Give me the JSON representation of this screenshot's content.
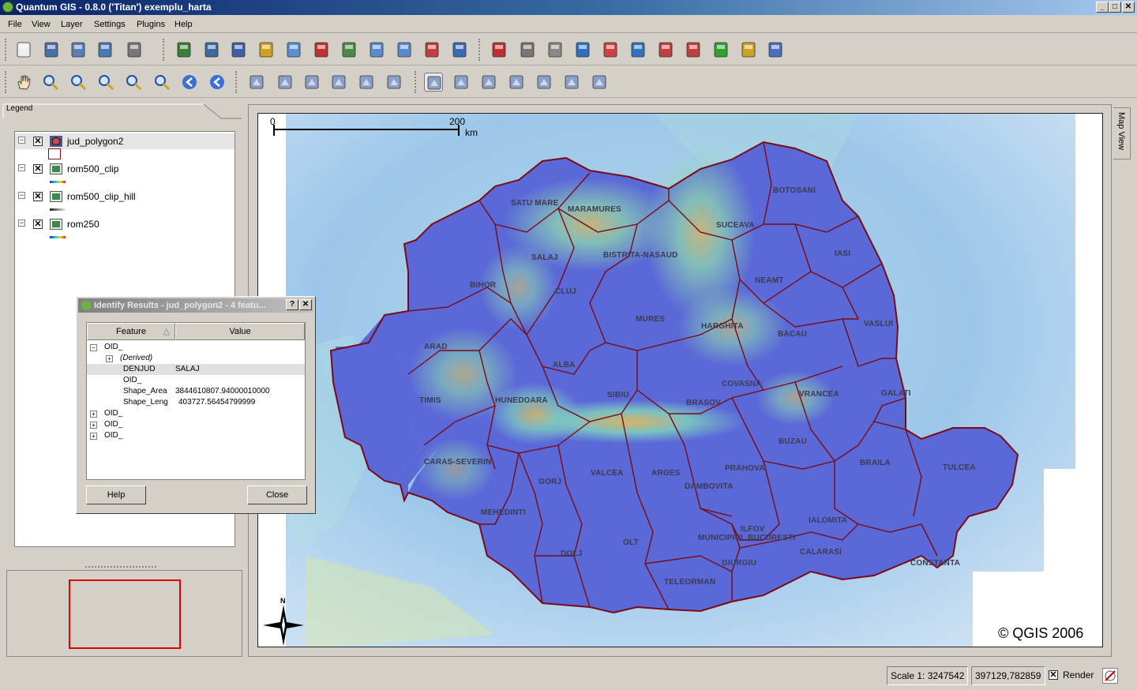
{
  "window": {
    "title": "Quantum GIS - 0.8.0 ('Titan')  exemplu_harta",
    "min": "_",
    "max": "□",
    "close": "✕"
  },
  "menu": [
    "File",
    "View",
    "Layer",
    "Settings",
    "Plugins",
    "Help"
  ],
  "legend": {
    "tab_label": "Legend",
    "layers": [
      {
        "name": "jud_polygon2",
        "checked": "✕",
        "expand": "−"
      },
      {
        "name": "rom500_clip",
        "checked": "✕",
        "expand": "−"
      },
      {
        "name": "rom500_clip_hill",
        "checked": "✕",
        "expand": "−"
      },
      {
        "name": "rom250",
        "checked": "✕",
        "expand": "−"
      }
    ]
  },
  "map": {
    "view_tab": "Map View",
    "scalebar": {
      "start": "0",
      "end": "200",
      "unit": "km"
    },
    "north": "N",
    "copyright": "© QGIS 2006",
    "labels": [
      "SATU MARE",
      "MARAMURES",
      "BOTOSANI",
      "SUCEAVA",
      "SALAJ",
      "BISTRITA-NASAUD",
      "IASI",
      "BIHOR",
      "CLUJ",
      "NEAMT",
      "VASLUI",
      "MURES",
      "HARGHITA",
      "BACAU",
      "ARAD",
      "ALBA",
      "COVASNA",
      "VRANCEA",
      "GALATI",
      "TIMIS",
      "HUNEDOARA",
      "SIBIU",
      "BRASOV",
      "BUZAU",
      "CARAS-SEVERIN",
      "BRAILA",
      "TULCEA",
      "VALCEA",
      "ARGES",
      "PRAHOVA",
      "GORJ",
      "DAMBOVITA",
      "MEHEDINTI",
      "ILFOV",
      "IALOMITA",
      "MUNICIPIUL BUCURESTI",
      "DOLJ",
      "OLT",
      "GIURGIU",
      "CALARASI",
      "CONSTANTA",
      "TELEORMAN"
    ]
  },
  "dialog": {
    "title": "Identify Results - jud_polygon2 - 4 featu...",
    "help_q": "?",
    "close_x": "✕",
    "col_feature": "Feature",
    "col_value": "Value",
    "rows": [
      {
        "indent": 0,
        "expander": "−",
        "label": "OID_",
        "value": ""
      },
      {
        "indent": 1,
        "expander": "+",
        "label": "(Derived)",
        "value": ""
      },
      {
        "indent": 2,
        "expander": "",
        "label": "DENJUD",
        "value": "SALAJ"
      },
      {
        "indent": 2,
        "expander": "",
        "label": "OID_",
        "value": ""
      },
      {
        "indent": 2,
        "expander": "",
        "label": "Shape_Area",
        "value": "3844610807.94000010000"
      },
      {
        "indent": 2,
        "expander": "",
        "label": "Shape_Leng",
        "value": "403727.56454799999"
      },
      {
        "indent": 0,
        "expander": "+",
        "label": "OID_",
        "value": ""
      },
      {
        "indent": 0,
        "expander": "+",
        "label": "OID_",
        "value": ""
      },
      {
        "indent": 0,
        "expander": "+",
        "label": "OID_",
        "value": ""
      }
    ],
    "help_button": "Help",
    "close_button": "Close"
  },
  "status": {
    "scale": "Scale 1: 3247542",
    "coords": "397129,782859",
    "render_checked": "✕",
    "render_label": "Render"
  },
  "toolbar1_icons": [
    "new-project-icon",
    "save-project-icon",
    "save-as-icon",
    "open-project-icon",
    "print-icon",
    "add-raster-icon",
    "add-wms-icon",
    "add-postgis-icon",
    "add-layer-icon",
    "new-layer-icon",
    "remove-layer-icon",
    "layer-props-icon",
    "show-all-icon",
    "hide-all-icon",
    "overview-icon",
    "capture-point-icon",
    "capture-line-icon",
    "capture-polygon-icon",
    "delete-selected-icon",
    "add-island-icon",
    "add-ring-icon",
    "move-vertex-icon",
    "add-vertex-icon",
    "delete-vertex-icon",
    "cut-icon",
    "copy-icon",
    "paste-icon"
  ],
  "toolbar2_icons": [
    "pan-icon",
    "zoom-in-icon",
    "zoom-out-icon",
    "zoom-full-icon",
    "zoom-selection-icon",
    "zoom-layer-icon",
    "zoom-last-icon",
    "refresh-icon",
    "add-raster2-icon",
    "add-vector2-icon",
    "digitize-icon",
    "split-icon",
    "merge-icon",
    "reshape-icon",
    "identify-icon",
    "select-icon",
    "attribute-table-icon",
    "measure-line-icon",
    "measure-area-icon",
    "map-tips-icon",
    "bookmark-icon"
  ]
}
